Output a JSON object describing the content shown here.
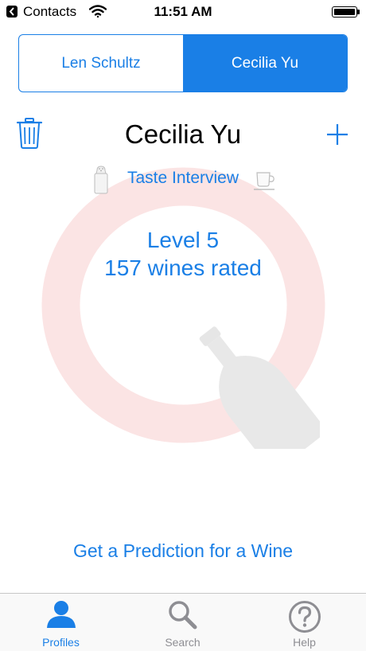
{
  "status_bar": {
    "back_label": "Contacts",
    "time": "11:51 AM"
  },
  "segments": [
    {
      "label": "Len Schultz",
      "selected": false
    },
    {
      "label": "Cecilia Yu",
      "selected": true
    }
  ],
  "profile": {
    "name": "Cecilia Yu",
    "taste_interview": "Taste Interview",
    "level": "Level 5",
    "wines_rated": "157 wines rated"
  },
  "prediction_link": "Get a Prediction for a Wine",
  "tabs": [
    {
      "label": "Profiles",
      "icon": "person-icon",
      "active": true
    },
    {
      "label": "Search",
      "icon": "search-icon",
      "active": false
    },
    {
      "label": "Help",
      "icon": "help-icon",
      "active": false
    }
  ],
  "colors": {
    "accent": "#1a7fe6",
    "ring": "#fbe4e4",
    "bottle": "#e8e8e8",
    "inactive_tab": "#8e8e93"
  }
}
